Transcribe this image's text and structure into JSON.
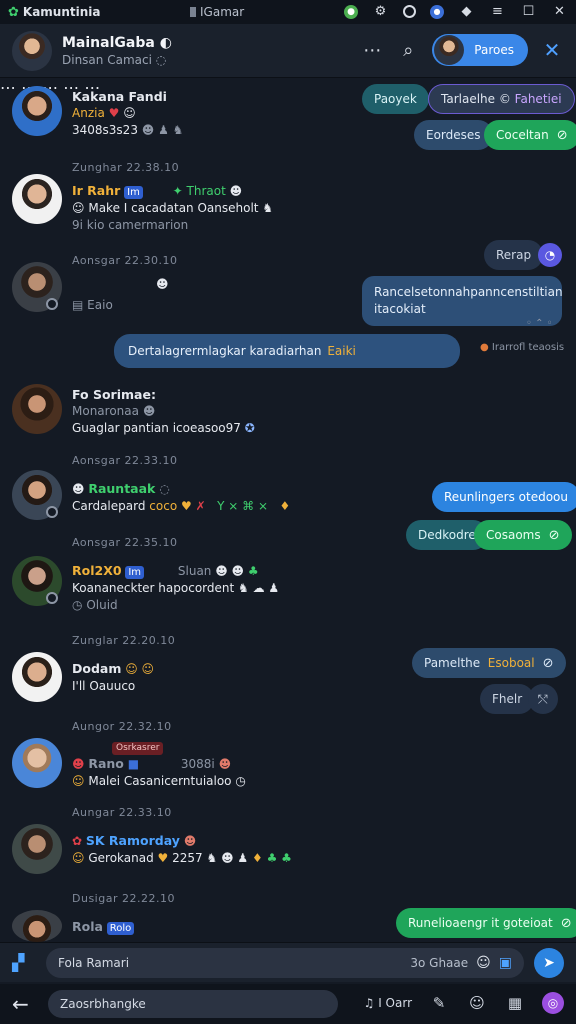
{
  "os": {
    "app_name": "Kamuntinia",
    "window_title": "IGamar"
  },
  "header": {
    "name": "MainalGaba",
    "subtitle": "Dinsan Camaci",
    "profile_pill_label": "Paroes"
  },
  "messages": [
    {
      "name": "Kakana Fandi",
      "line2": "Anzia",
      "line3": "3408s3s23",
      "timestamp": "Zunghar 22.38.10"
    },
    {
      "name": "Ir Rahr",
      "tag": "Im",
      "extra": "Thraot",
      "text": "Make I cacadatan Oanseholt",
      "sub": "9i kio camermarion"
    },
    {
      "divider": "Aonsgar 22.30.10",
      "sub": "Eaio"
    },
    {
      "name": "Fo Sorimae:",
      "line2": "Monaronaa",
      "text": "Guaglar pantian icoeasoo97"
    },
    {
      "divider": "Aonsgar 22.33.10",
      "name": "Rauntaak",
      "text": "Cardalepard",
      "emoji_text": "coco"
    },
    {
      "divider": "Aonsgar 22.35.10",
      "name": "Rol2X0",
      "tag": "Im",
      "extra": "Sluan",
      "text": "Koananeckter hapocordent",
      "sub": "Oluid"
    },
    {
      "divider": "Zunglar 22.20.10",
      "name": "Dodam",
      "sub": "I'll Oauuco"
    },
    {
      "divider": "Aungor 22.32.10",
      "red_tag": "Osrkasrer",
      "name": "Rano",
      "extra": "3088i",
      "text": "Malei Casanicerntuialoo"
    },
    {
      "divider": "Aungar 22.33.10",
      "name": "SK Ramorday",
      "text": "Gerokanad",
      "extra": "2257"
    },
    {
      "divider": "Dusigar 22.22.10",
      "name": "Rola",
      "tag": "Rolo"
    }
  ],
  "right_pills": {
    "p1": "Paoyek",
    "p2": "Tarlaelhe ©",
    "p2b": "Fahetiei",
    "p3": "Eordeses",
    "p4": "Coceltan",
    "p5": "Rerap",
    "big_bubble": "Rancelsetonnahpanncenstiltian itacokiat",
    "p6": "Reunlingers otedoou",
    "p7": "Dedkodre",
    "p8": "Cosaoms",
    "p9": "Pamelthe",
    "p9b": "Esoboal",
    "p10": "Fhelr",
    "p11": "Runelioaengr it goteioat"
  },
  "system_bubble": {
    "text": "Dertalagrermlagkar karadiarhan",
    "highlight": "Eaiki"
  },
  "system_aside": "Irarrofl teaosis",
  "composer": {
    "placeholder": "Fola Ramari",
    "counter": "3o Ghaae"
  },
  "bottom": {
    "search_text": "Zaosrbhangke",
    "tool_text": "I Oarr"
  },
  "colors": {
    "bg": "#141a24",
    "accent_blue": "#2c84e0",
    "accent_green": "#1fa55a",
    "accent_amber": "#f0b13a"
  }
}
